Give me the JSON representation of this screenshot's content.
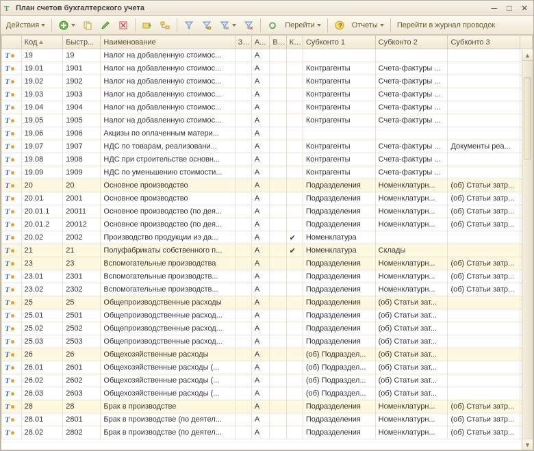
{
  "window": {
    "title": "План счетов бухгалтерского учета"
  },
  "toolbar": {
    "actions_label": "Действия",
    "goto_label": "Перейти",
    "reports_label": "Отчеты",
    "journal_label": "Перейти в журнал проводок"
  },
  "columns": {
    "icon": "",
    "code": "Код",
    "fast": "Быстр...",
    "name": "Наименование",
    "z": "З...",
    "a": "А...",
    "v": "В...",
    "k": "К...",
    "sub1": "Субконто 1",
    "sub2": "Субконто 2",
    "sub3": "Субконто 3"
  },
  "rows": [
    {
      "hl": false,
      "code": "19",
      "fast": "19",
      "name": "Налог на добавленную стоимос...",
      "a": "А",
      "v": "",
      "k": "",
      "s1": "",
      "s2": "",
      "s3": ""
    },
    {
      "hl": false,
      "code": "19.01",
      "fast": "1901",
      "name": "Налог на добавленную стоимос...",
      "a": "А",
      "v": "",
      "k": "",
      "s1": "Контрагенты",
      "s2": "Счета-фактуры ...",
      "s3": ""
    },
    {
      "hl": false,
      "code": "19.02",
      "fast": "1902",
      "name": "Налог на добавленную стоимос...",
      "a": "А",
      "v": "",
      "k": "",
      "s1": "Контрагенты",
      "s2": "Счета-фактуры ...",
      "s3": ""
    },
    {
      "hl": false,
      "code": "19.03",
      "fast": "1903",
      "name": "Налог на добавленную стоимос...",
      "a": "А",
      "v": "",
      "k": "",
      "s1": "Контрагенты",
      "s2": "Счета-фактуры ...",
      "s3": ""
    },
    {
      "hl": false,
      "code": "19.04",
      "fast": "1904",
      "name": "Налог на добавленную стоимос...",
      "a": "А",
      "v": "",
      "k": "",
      "s1": "Контрагенты",
      "s2": "Счета-фактуры ...",
      "s3": ""
    },
    {
      "hl": false,
      "code": "19.05",
      "fast": "1905",
      "name": "Налог на добавленную стоимос...",
      "a": "А",
      "v": "",
      "k": "",
      "s1": "Контрагенты",
      "s2": "Счета-фактуры ...",
      "s3": ""
    },
    {
      "hl": false,
      "code": "19.06",
      "fast": "1906",
      "name": "Акцизы по оплаченным матери...",
      "a": "А",
      "v": "",
      "k": "",
      "s1": "",
      "s2": "",
      "s3": ""
    },
    {
      "hl": false,
      "code": "19.07",
      "fast": "1907",
      "name": "НДС по товарам, реализовани...",
      "a": "А",
      "v": "",
      "k": "",
      "s1": "Контрагенты",
      "s2": "Счета-фактуры ...",
      "s3": "Документы реа..."
    },
    {
      "hl": false,
      "code": "19.08",
      "fast": "1908",
      "name": "НДС при строительстве основн...",
      "a": "А",
      "v": "",
      "k": "",
      "s1": "Контрагенты",
      "s2": "Счета-фактуры ...",
      "s3": ""
    },
    {
      "hl": false,
      "code": "19.09",
      "fast": "1909",
      "name": "НДС по уменьшению стоимости...",
      "a": "А",
      "v": "",
      "k": "",
      "s1": "Контрагенты",
      "s2": "Счета-фактуры ...",
      "s3": ""
    },
    {
      "hl": true,
      "code": "20",
      "fast": "20",
      "name": "Основное производство",
      "a": "А",
      "v": "",
      "k": "",
      "s1": "Подразделения",
      "s2": "Номенклатурн...",
      "s3": "(об) Статьи затр..."
    },
    {
      "hl": false,
      "code": "20.01",
      "fast": "2001",
      "name": "Основное производство",
      "a": "А",
      "v": "",
      "k": "",
      "s1": "Подразделения",
      "s2": "Номенклатурн...",
      "s3": "(об) Статьи затр..."
    },
    {
      "hl": false,
      "code": "20.01.1",
      "fast": "20011",
      "name": "Основное производство (по дея...",
      "a": "А",
      "v": "",
      "k": "",
      "s1": "Подразделения",
      "s2": "Номенклатурн...",
      "s3": "(об) Статьи затр..."
    },
    {
      "hl": false,
      "code": "20.01.2",
      "fast": "20012",
      "name": "Основное производство (по дея...",
      "a": "А",
      "v": "",
      "k": "",
      "s1": "Подразделения",
      "s2": "Номенклатурн...",
      "s3": "(об) Статьи затр..."
    },
    {
      "hl": false,
      "code": "20.02",
      "fast": "2002",
      "name": "Производство продукции из да...",
      "a": "А",
      "v": "",
      "k": "✔",
      "s1": "Номенклатура",
      "s2": "",
      "s3": ""
    },
    {
      "hl": true,
      "code": "21",
      "fast": "21",
      "name": "Полуфабрикаты собственного п...",
      "a": "А",
      "v": "",
      "k": "✔",
      "s1": "Номенклатура",
      "s2": "Склады",
      "s3": ""
    },
    {
      "hl": true,
      "code": "23",
      "fast": "23",
      "name": "Вспомогательные производства",
      "a": "А",
      "v": "",
      "k": "",
      "s1": "Подразделения",
      "s2": "Номенклатурн...",
      "s3": "(об) Статьи затр..."
    },
    {
      "hl": false,
      "code": "23.01",
      "fast": "2301",
      "name": "Вспомогательные производств...",
      "a": "А",
      "v": "",
      "k": "",
      "s1": "Подразделения",
      "s2": "Номенклатурн...",
      "s3": "(об) Статьи затр..."
    },
    {
      "hl": false,
      "code": "23.02",
      "fast": "2302",
      "name": "Вспомогательные производств...",
      "a": "А",
      "v": "",
      "k": "",
      "s1": "Подразделения",
      "s2": "Номенклатурн...",
      "s3": "(об) Статьи затр..."
    },
    {
      "hl": true,
      "code": "25",
      "fast": "25",
      "name": "Общепроизводственные расходы",
      "a": "А",
      "v": "",
      "k": "",
      "s1": "Подразделения",
      "s2": "(об) Статьи зат...",
      "s3": ""
    },
    {
      "hl": false,
      "code": "25.01",
      "fast": "2501",
      "name": "Общепроизводственные расход...",
      "a": "А",
      "v": "",
      "k": "",
      "s1": "Подразделения",
      "s2": "(об) Статьи зат...",
      "s3": ""
    },
    {
      "hl": false,
      "code": "25.02",
      "fast": "2502",
      "name": "Общепроизводственные расход...",
      "a": "А",
      "v": "",
      "k": "",
      "s1": "Подразделения",
      "s2": "(об) Статьи зат...",
      "s3": ""
    },
    {
      "hl": false,
      "code": "25.03",
      "fast": "2503",
      "name": "Общепроизводственные расход...",
      "a": "А",
      "v": "",
      "k": "",
      "s1": "Подразделения",
      "s2": "(об) Статьи зат...",
      "s3": ""
    },
    {
      "hl": true,
      "code": "26",
      "fast": "26",
      "name": "Общехозяйственные расходы",
      "a": "А",
      "v": "",
      "k": "",
      "s1": "(об) Подраздел...",
      "s2": "(об) Статьи зат...",
      "s3": ""
    },
    {
      "hl": false,
      "code": "26.01",
      "fast": "2601",
      "name": "Общехозяйственные расходы (...",
      "a": "А",
      "v": "",
      "k": "",
      "s1": "(об) Подраздел...",
      "s2": "(об) Статьи зат...",
      "s3": ""
    },
    {
      "hl": false,
      "code": "26.02",
      "fast": "2602",
      "name": "Общехозяйственные расходы (...",
      "a": "А",
      "v": "",
      "k": "",
      "s1": "(об) Подраздел...",
      "s2": "(об) Статьи зат...",
      "s3": ""
    },
    {
      "hl": false,
      "code": "26.03",
      "fast": "2603",
      "name": "Общехозяйственные расходы (...",
      "a": "А",
      "v": "",
      "k": "",
      "s1": "(об) Подраздел...",
      "s2": "(об) Статьи зат...",
      "s3": ""
    },
    {
      "hl": true,
      "code": "28",
      "fast": "28",
      "name": "Брак в производстве",
      "a": "А",
      "v": "",
      "k": "",
      "s1": "Подразделения",
      "s2": "Номенклатурн...",
      "s3": "(об) Статьи затр..."
    },
    {
      "hl": false,
      "code": "28.01",
      "fast": "2801",
      "name": "Брак в производстве (по деятел...",
      "a": "А",
      "v": "",
      "k": "",
      "s1": "Подразделения",
      "s2": "Номенклатурн...",
      "s3": "(об) Статьи затр..."
    },
    {
      "hl": false,
      "code": "28.02",
      "fast": "2802",
      "name": "Брак в производстве (по деятел...",
      "a": "А",
      "v": "",
      "k": "",
      "s1": "Подразделения",
      "s2": "Номенклатурн...",
      "s3": "(об) Статьи затр..."
    }
  ]
}
